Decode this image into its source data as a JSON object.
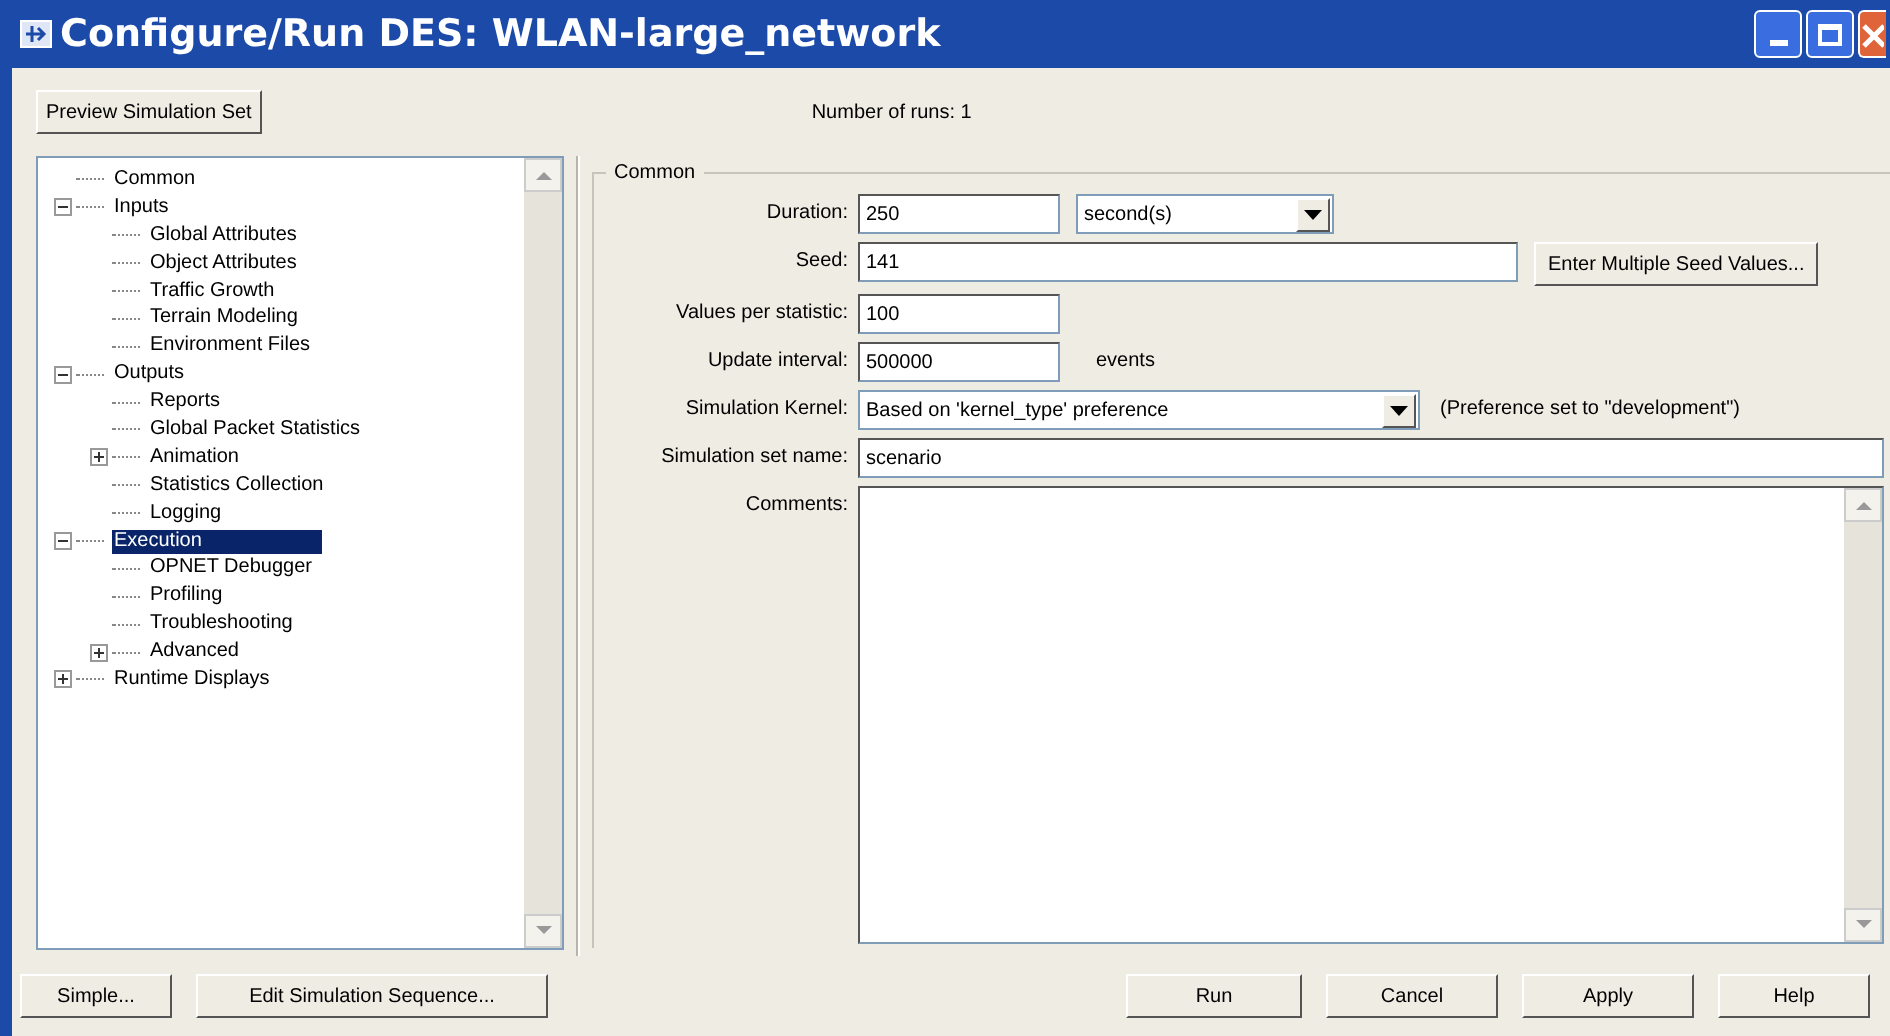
{
  "window": {
    "title": "Configure/Run DES: WLAN-large_network"
  },
  "toolbar": {
    "preview_button": "Preview Simulation Set",
    "number_of_runs": "Number of runs: 1"
  },
  "tree": [
    {
      "label": "Common",
      "selected": false
    },
    {
      "label": "Inputs",
      "selected": false,
      "expanded": true,
      "children": [
        {
          "label": "Global Attributes",
          "selected": false
        },
        {
          "label": "Object Attributes",
          "selected": false
        },
        {
          "label": "Traffic Growth",
          "selected": false
        },
        {
          "label": "Terrain Modeling",
          "selected": false
        },
        {
          "label": "Environment Files",
          "selected": false
        }
      ]
    },
    {
      "label": "Outputs",
      "selected": false,
      "expanded": true,
      "children": [
        {
          "label": "Reports",
          "selected": false
        },
        {
          "label": "Global Packet Statistics",
          "selected": false
        },
        {
          "label": "Animation",
          "selected": false,
          "expanded": false
        },
        {
          "label": "Statistics Collection",
          "selected": false
        },
        {
          "label": "Logging",
          "selected": false
        }
      ]
    },
    {
      "label": "Execution",
      "selected": true,
      "expanded": true,
      "children": [
        {
          "label": "OPNET Debugger",
          "selected": false
        },
        {
          "label": "Profiling",
          "selected": false
        },
        {
          "label": "Troubleshooting",
          "selected": false
        },
        {
          "label": "Advanced",
          "selected": false,
          "expanded": false
        }
      ]
    },
    {
      "label": "Runtime Displays",
      "selected": false,
      "expanded": false
    }
  ],
  "group": {
    "title": "Common",
    "fields": [
      {
        "kind": "value_unit",
        "label": "Duration:",
        "value": "250",
        "unit": "second(s)"
      },
      {
        "kind": "value_button",
        "label": "Seed:",
        "value": "141",
        "button": "Enter Multiple Seed Values..."
      },
      {
        "kind": "value",
        "label": "Values per statistic:",
        "value": "100"
      },
      {
        "kind": "value_suffix",
        "label": "Update interval:",
        "value": "500000",
        "suffix": "events"
      },
      {
        "kind": "select_note",
        "label": "Simulation Kernel:",
        "value": "Based on 'kernel_type' preference",
        "note": "(Preference set to \"development\")"
      },
      {
        "kind": "wide",
        "label": "Simulation set name:",
        "value": "scenario"
      },
      {
        "kind": "textarea",
        "label": "Comments:"
      }
    ]
  },
  "footer": {
    "left_buttons": [
      "Simple...",
      "Edit Simulation Sequence..."
    ],
    "right_buttons": [
      "Run",
      "Cancel",
      "Apply",
      "Help"
    ]
  }
}
